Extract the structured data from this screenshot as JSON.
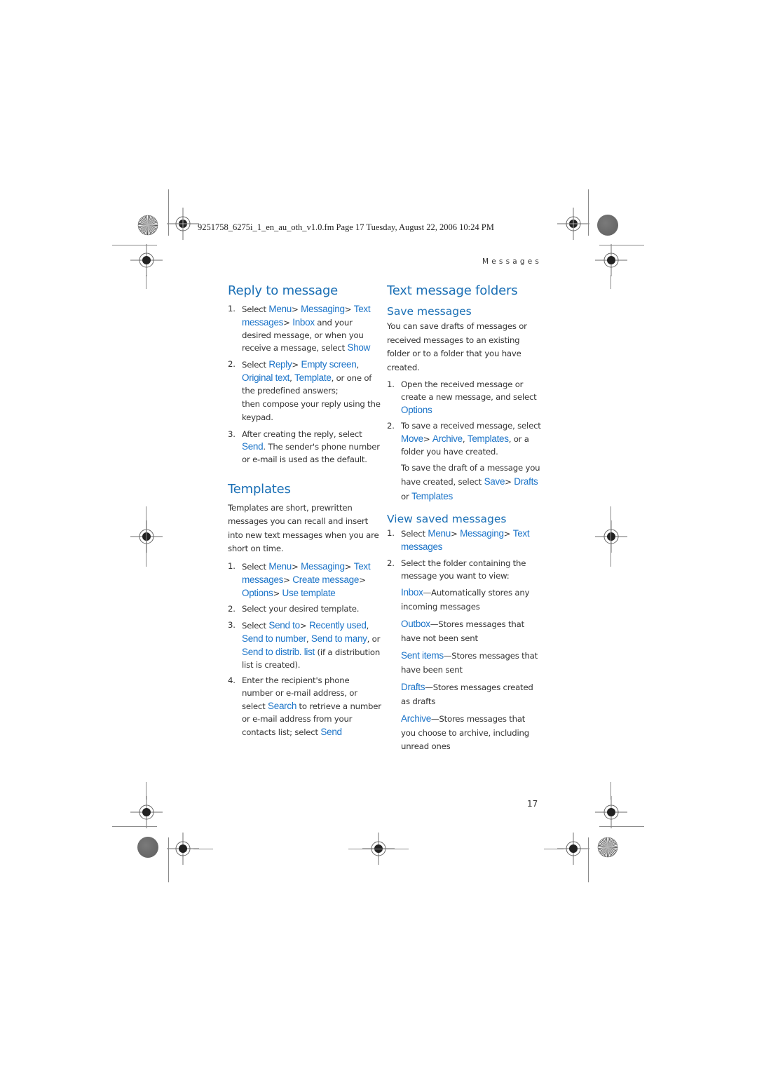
{
  "header": {
    "file_info": "9251758_6275i_1_en_au_oth_v1.0.fm  Page 17  Tuesday, August 22, 2006  10:24 PM",
    "running_head": "Messages",
    "page_number": "17"
  },
  "colors": {
    "heading": "#1a6fb5",
    "ui_term": "#1a73c8",
    "body_text": "#333333"
  },
  "left_column": {
    "reply": {
      "title": "Reply to message",
      "steps": [
        {
          "num": "1.",
          "parts": [
            "Select ",
            "Menu",
            "> ",
            "Messaging",
            "> ",
            "Text messages",
            "> ",
            "Inbox",
            " and your desired message, or when you receive a message, select ",
            "Show"
          ]
        },
        {
          "num": "2.",
          "parts": [
            "Select ",
            "Reply",
            "> ",
            "Empty screen",
            ", ",
            "Original text",
            ", ",
            "Template",
            ", or one of the predefined answers;"
          ],
          "continuation": "then compose your reply using the keypad."
        },
        {
          "num": "3.",
          "parts": [
            "After creating the reply, select ",
            "Send",
            ". The sender's phone number or e-mail is used as the default."
          ]
        }
      ]
    },
    "templates": {
      "title": "Templates",
      "intro": "Templates are short, prewritten messages you can recall and insert into new text messages when you are short on time.",
      "steps": [
        {
          "num": "1.",
          "parts": [
            "Select ",
            "Menu",
            "> ",
            "Messaging",
            "> ",
            "Text messages",
            "> ",
            "Create message",
            "> ",
            "Options",
            "> ",
            "Use template"
          ]
        },
        {
          "num": "2.",
          "parts": [
            "Select your desired template."
          ]
        },
        {
          "num": "3.",
          "parts": [
            "Select ",
            "Send to",
            "> ",
            "Recently used",
            ", ",
            "Send to number",
            ", ",
            "Send to many",
            ", or ",
            "Send to distrib. list",
            " (if a distribution list is created)."
          ]
        },
        {
          "num": "4.",
          "parts": [
            "Enter the recipient's phone number or e-mail address, or select ",
            "Search",
            " to retrieve a number or e-mail address from your contacts list; select ",
            "Send"
          ]
        }
      ]
    }
  },
  "right_column": {
    "title": "Text message folders",
    "save": {
      "title": "Save messages",
      "intro": "You can save drafts of messages or received messages to an existing folder or to a folder that you have created.",
      "steps": [
        {
          "num": "1.",
          "parts": [
            "Open the received message or create a new message, and select ",
            "Options"
          ]
        },
        {
          "num": "2.",
          "parts": [
            "To save a received message, select ",
            "Move",
            "> ",
            "Archive",
            ", ",
            "Templates",
            ", or a folder you have created."
          ],
          "sub_parts": [
            "To save the draft of a message you have created, select ",
            "Save",
            "> ",
            "Drafts",
            " or ",
            "Templates"
          ]
        }
      ]
    },
    "view": {
      "title": "View saved messages",
      "steps": [
        {
          "num": "1.",
          "parts": [
            "Select ",
            "Menu",
            "> ",
            "Messaging",
            "> ",
            "Text messages"
          ]
        },
        {
          "num": "2.",
          "parts": [
            "Select the folder containing the message you want to view:"
          ]
        }
      ],
      "folders": [
        {
          "name": "Inbox",
          "desc": "—Automatically stores any incoming messages"
        },
        {
          "name": "Outbox",
          "desc": "—Stores messages that have not been sent"
        },
        {
          "name": "Sent items",
          "desc": "—Stores messages that have been sent"
        },
        {
          "name": "Drafts",
          "desc": "—Stores messages created as drafts"
        },
        {
          "name": "Archive",
          "desc": "—Stores messages that you choose to archive, including unread ones"
        }
      ]
    }
  }
}
